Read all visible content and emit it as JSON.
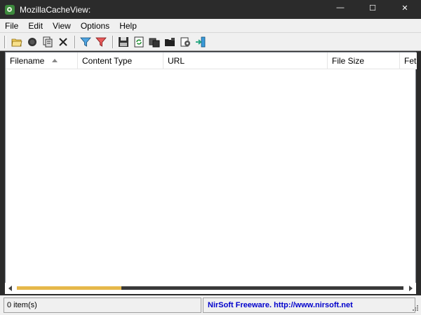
{
  "window": {
    "title": "MozillaCacheView:",
    "minimize_glyph": "—",
    "maximize_glyph": "☐",
    "close_glyph": "✕"
  },
  "menu": {
    "items": [
      "File",
      "Edit",
      "View",
      "Options",
      "Help"
    ]
  },
  "toolbar": {
    "buttons": [
      "open-folder-icon",
      "record-icon",
      "copy-icon",
      "delete-icon",
      "filter-icon",
      "clear-filter-icon",
      "save-icon",
      "refresh-icon",
      "copy-files-icon",
      "folder-dark-icon",
      "properties-icon",
      "exit-icon"
    ]
  },
  "list": {
    "columns": [
      "Filename",
      "Content Type",
      "URL",
      "File Size",
      "Fet"
    ],
    "sorted_column": "Filename",
    "rows": []
  },
  "hscroll": {
    "thumb_fraction": 0.27
  },
  "status": {
    "items": "0 item(s)",
    "credit": "NirSoft Freeware.  http://www.nirsoft.net"
  },
  "colors": {
    "titlebar": "#2b2b2b",
    "scroll_thumb": "#e6b84a",
    "credit_link": "#0000cc"
  }
}
